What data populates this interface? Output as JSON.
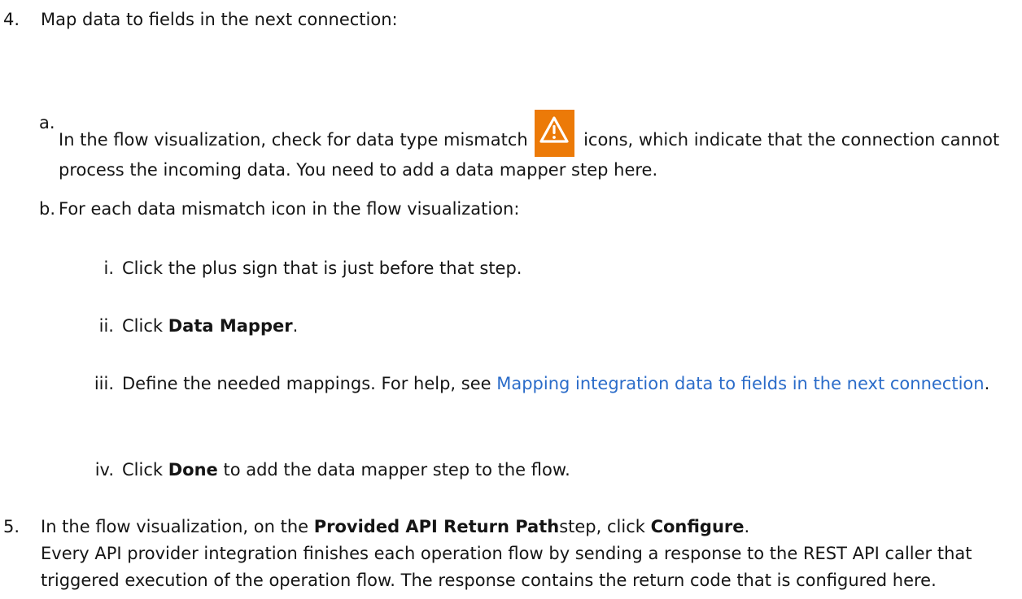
{
  "step4": {
    "marker": "4.",
    "text": "Map data to fields in the next connection:"
  },
  "step4a": {
    "marker": "a.",
    "before_icon": "In the flow visualization, check for data type mismatch",
    "icon": "warning-triangle-icon",
    "icon_color": "#ec7a08",
    "after_icon": "icons, which indicate that the connection cannot process the incoming data. You need to add a data mapper step here."
  },
  "step4b": {
    "marker": "b.",
    "text": "For each data mismatch icon in the flow visualization:"
  },
  "step4b_i": {
    "marker": "i.",
    "text": "Click the plus sign that is just before that step."
  },
  "step4b_ii": {
    "marker": "ii.",
    "prefix": "Click ",
    "bold": "Data Mapper",
    "suffix": "."
  },
  "step4b_iii": {
    "marker": "iii.",
    "prefix": "Define the needed mappings. For help, see ",
    "link": "Mapping integration data to fields in the next connection",
    "link_color": "#2b6cc9",
    "suffix": "."
  },
  "step4b_iv": {
    "marker": "iv.",
    "prefix": "Click ",
    "bold": "Done",
    "suffix": " to add the data mapper step to the flow."
  },
  "step5": {
    "marker": "5.",
    "prefix": "In the flow visualization, on the ",
    "bold1": "Provided API Return Path",
    "middle": "step, click ",
    "bold2": "Configure",
    "suffix": ".",
    "paragraph": "Every API provider integration finishes each operation flow by sending a response to the REST API caller that triggered execution of the operation flow. The response contains the return code that is configured here."
  }
}
